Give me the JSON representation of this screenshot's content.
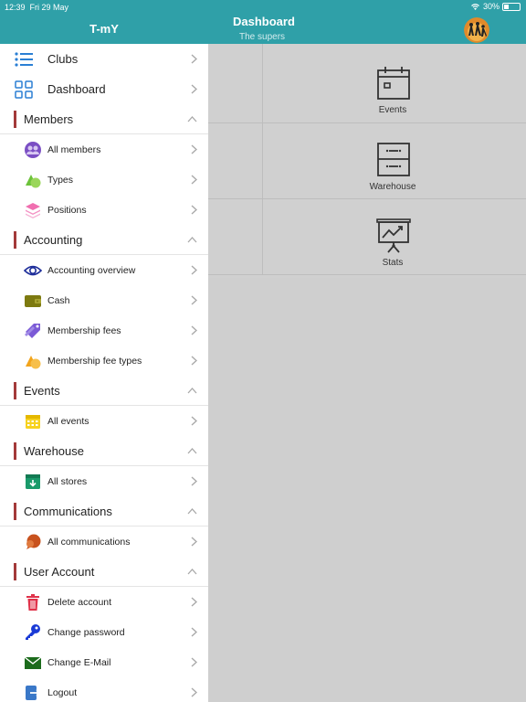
{
  "status": {
    "time": "12:39",
    "date": "Fri 29 May",
    "battery": "30%",
    "battery_level": 0.3
  },
  "sidebar": {
    "title": "T-mY",
    "top_items": [
      {
        "label": "Clubs",
        "icon": "list-icon"
      },
      {
        "label": "Dashboard",
        "icon": "grid-icon"
      }
    ],
    "sections": [
      {
        "title": "Members",
        "items": [
          {
            "label": "All members",
            "icon": "members-icon"
          },
          {
            "label": "Types",
            "icon": "shapes-icon"
          },
          {
            "label": "Positions",
            "icon": "layers-icon"
          }
        ]
      },
      {
        "title": "Accounting",
        "items": [
          {
            "label": "Accounting overview",
            "icon": "eye-icon"
          },
          {
            "label": "Cash",
            "icon": "wallet-icon"
          },
          {
            "label": "Membership fees",
            "icon": "tag-icon"
          },
          {
            "label": "Membership fee types",
            "icon": "shapes-icon"
          }
        ]
      },
      {
        "title": "Events",
        "items": [
          {
            "label": "All events",
            "icon": "calendar-icon"
          }
        ]
      },
      {
        "title": "Warehouse",
        "items": [
          {
            "label": "All stores",
            "icon": "store-icon"
          }
        ]
      },
      {
        "title": "Communications",
        "items": [
          {
            "label": "All communications",
            "icon": "chat-icon"
          }
        ]
      },
      {
        "title": "User Account",
        "items": [
          {
            "label": "Delete account",
            "icon": "trash-icon"
          },
          {
            "label": "Change password",
            "icon": "key-icon"
          },
          {
            "label": "Change E-Mail",
            "icon": "mail-icon"
          },
          {
            "label": "Logout",
            "icon": "logout-icon"
          }
        ]
      }
    ]
  },
  "header": {
    "title": "Dashboard",
    "subtitle": "The supers"
  },
  "dashboard": {
    "tiles": [
      {
        "label": "Events",
        "icon": "calendar-icon"
      },
      {
        "label": "Warehouse",
        "icon": "cabinet-icon"
      },
      {
        "label": "Stats",
        "icon": "presentation-chart-icon"
      }
    ]
  },
  "colors": {
    "accent": "#2fa0a8",
    "section_bar": "#a33a3a",
    "background": "#cfcfcf"
  }
}
